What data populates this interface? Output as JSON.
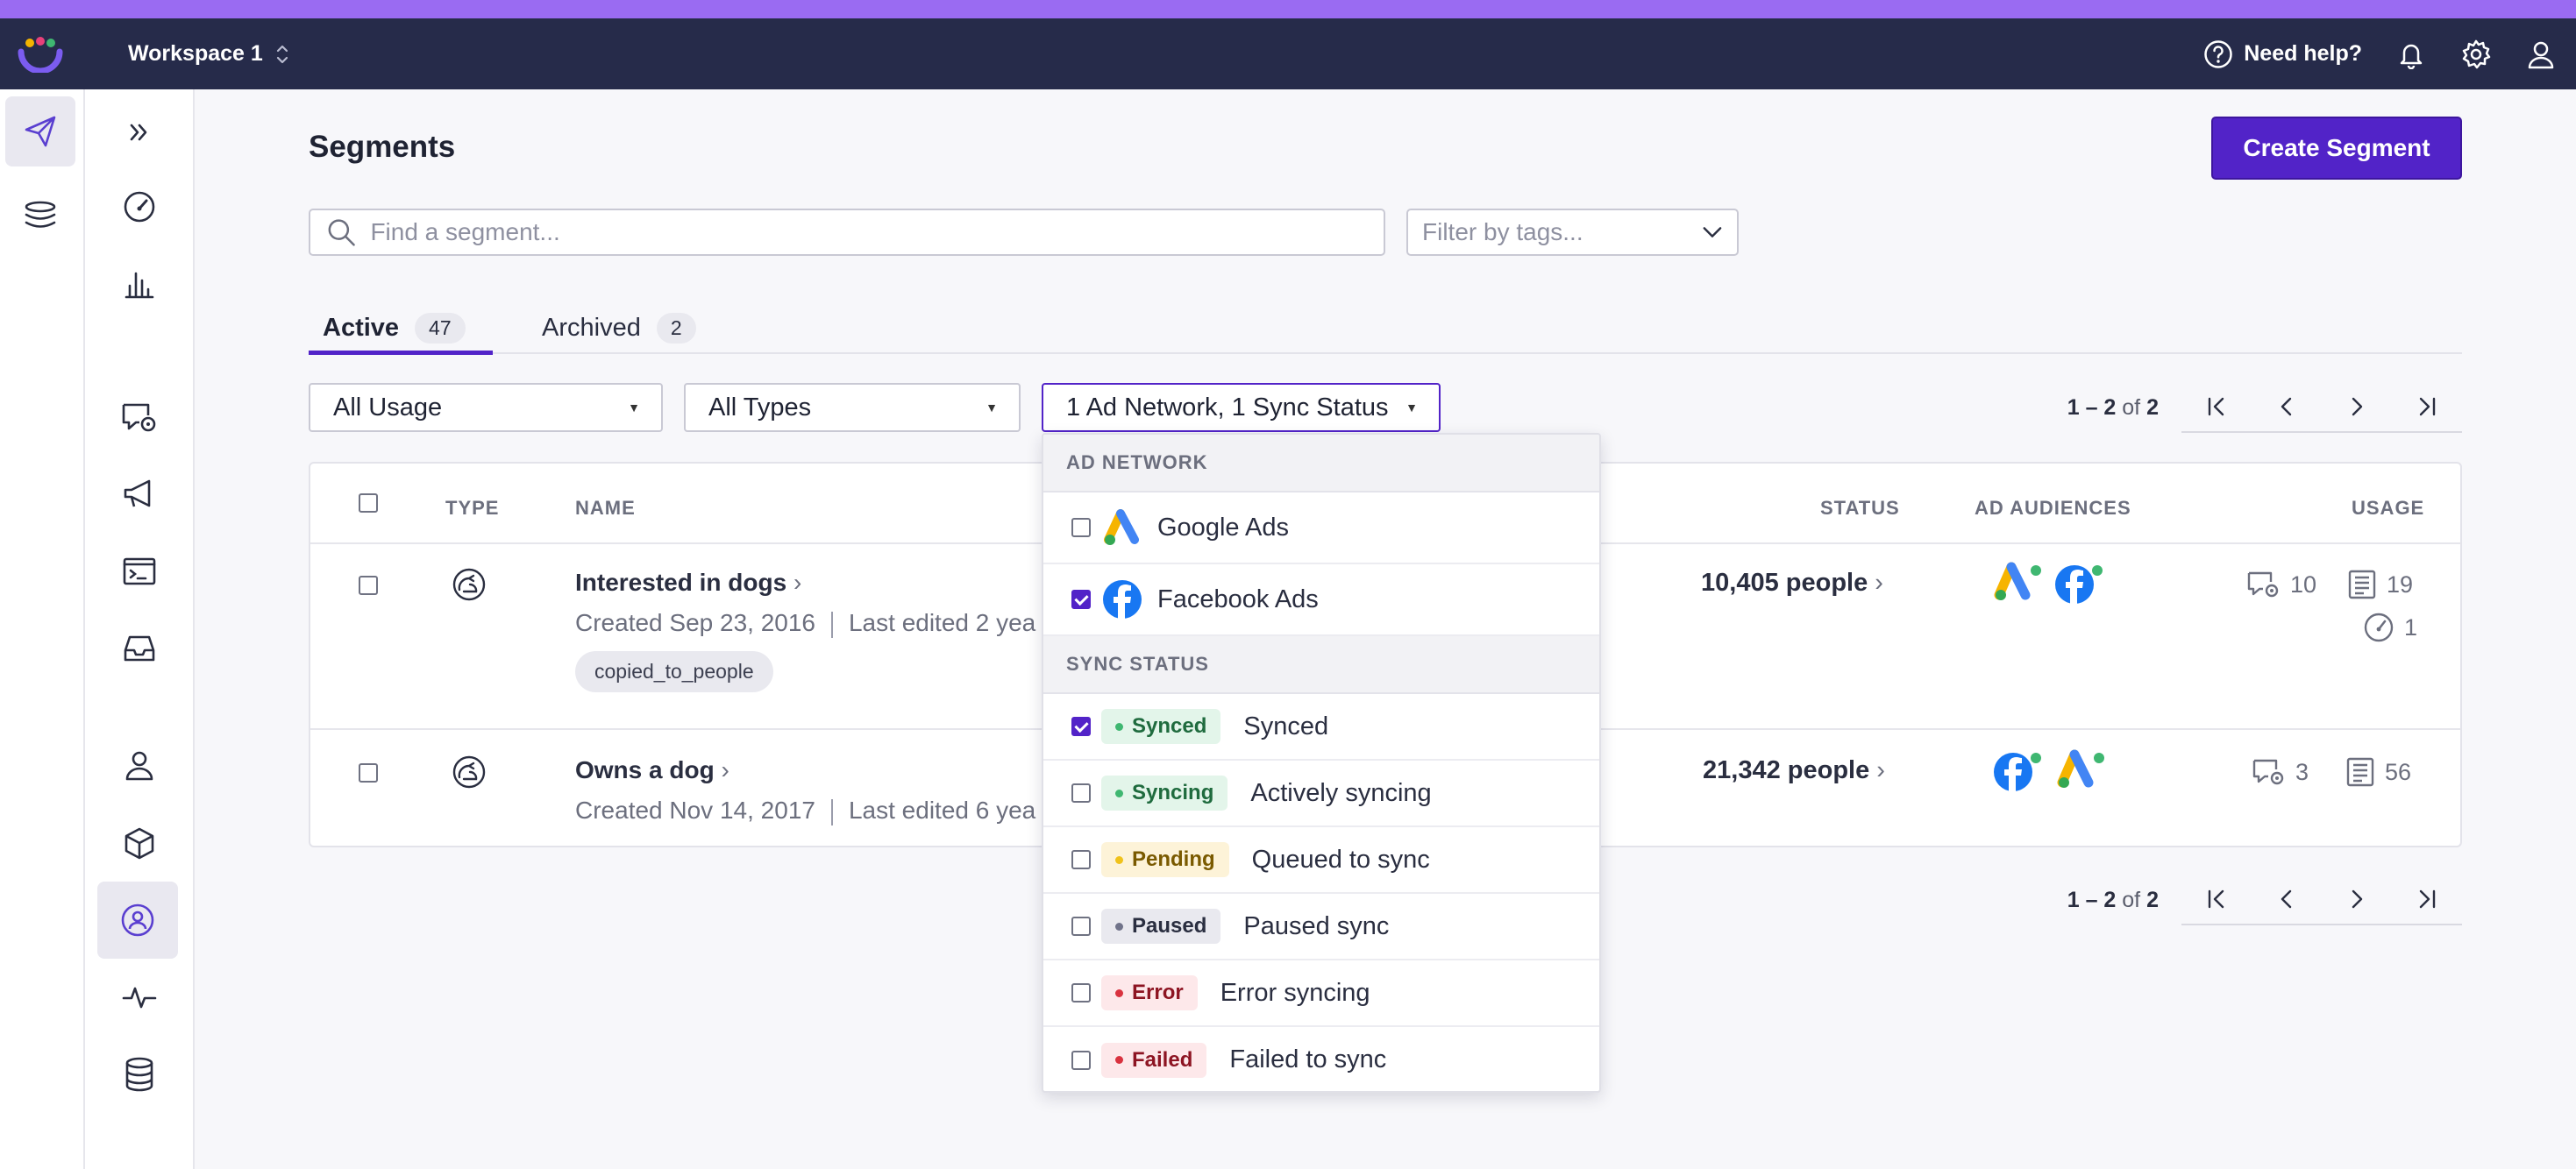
{
  "app": {
    "workspace_name": "Workspace 1",
    "help_label": "Need help?"
  },
  "page": {
    "title": "Segments",
    "create_button": "Create Segment",
    "search_placeholder": "Find a segment...",
    "tags_placeholder": "Filter by tags..."
  },
  "tabs": [
    {
      "label": "Active",
      "count": "47"
    },
    {
      "label": "Archived",
      "count": "2"
    }
  ],
  "filters": {
    "usage": "All Usage",
    "types": "All Types",
    "network_status": "1 Ad Network, 1 Sync Status"
  },
  "pagination": {
    "range": "1 – 2",
    "of_label": "of",
    "total": "2"
  },
  "table": {
    "columns": {
      "type": "TYPE",
      "name": "NAME",
      "status": "STATUS",
      "ad_audiences": "AD AUDIENCES",
      "usage": "USAGE"
    },
    "rows": [
      {
        "name": "Interested in dogs",
        "created": "Created Sep 23, 2016",
        "edited": "Last edited 2 yea",
        "tag": "copied_to_people",
        "people": "10,405 people",
        "usage_messages": "10",
        "usage_docs": "19",
        "usage_dash": "1"
      },
      {
        "name": "Owns a dog",
        "created": "Created Nov 14, 2017",
        "edited": "Last edited 6 yea",
        "people": "21,342 people",
        "usage_messages": "3",
        "usage_docs": "56"
      }
    ]
  },
  "dropdown": {
    "ad_network_header": "AD NETWORK",
    "networks": [
      {
        "label": "Google Ads",
        "checked": false
      },
      {
        "label": "Facebook Ads",
        "checked": true
      }
    ],
    "sync_header": "SYNC STATUS",
    "statuses": [
      {
        "badge": "Synced",
        "label": "Synced",
        "checked": true,
        "bg": "#e3f5ea",
        "fg": "#1f6b3e",
        "dot": "#3fb771"
      },
      {
        "badge": "Syncing",
        "label": "Actively syncing",
        "checked": false,
        "bg": "#e3f5ea",
        "fg": "#1f6b3e",
        "dot": "#3fb771"
      },
      {
        "badge": "Pending",
        "label": "Queued to sync",
        "checked": false,
        "bg": "#fdf3d8",
        "fg": "#7a5a00",
        "dot": "#f0c21b"
      },
      {
        "badge": "Paused",
        "label": "Paused sync",
        "checked": false,
        "bg": "#e9e9ef",
        "fg": "#2a2e40",
        "dot": "#70738a"
      },
      {
        "badge": "Error",
        "label": "Error syncing",
        "checked": false,
        "bg": "#fde8ea",
        "fg": "#8d1422",
        "dot": "#d9323f"
      },
      {
        "badge": "Failed",
        "label": "Failed to sync",
        "checked": false,
        "bg": "#fde8ea",
        "fg": "#8d1422",
        "dot": "#d9323f"
      }
    ]
  },
  "colors": {
    "accent": "#5223c8",
    "topbar": "#262b4a",
    "strip": "#9a6bf2"
  }
}
